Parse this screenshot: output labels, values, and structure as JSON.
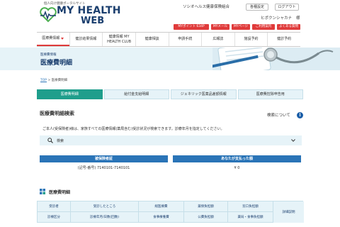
{
  "header": {
    "tagline": "個人向け健康ポータルサイト",
    "logo_line1": "MY HEALTH",
    "logo_line2": "WEB",
    "org_name": "ソシオヘルス健康保険組合",
    "buttons": [
      "各種設定",
      "ログアウト"
    ],
    "user_name": "ヒポクンシャカナ",
    "user_suffix": "様",
    "links": [
      "MYポイント 634P",
      "MYメール",
      "MYページ",
      "ご利用案内",
      "よくある質問"
    ]
  },
  "nav": {
    "items": [
      {
        "label": "医療費情報",
        "dropdown": true
      },
      {
        "label": "健診結果情報",
        "dropdown": false
      },
      {
        "label": "健康情報 MY HEALTH CLUB",
        "dropdown": false
      },
      {
        "label": "健康相談",
        "dropdown": false
      },
      {
        "label": "申請手続",
        "dropdown": false
      },
      {
        "label": "広報誌",
        "dropdown": false
      },
      {
        "label": "施設予約",
        "dropdown": false
      },
      {
        "label": "健診予約",
        "dropdown": false
      }
    ],
    "active_index": 0
  },
  "banner": {
    "subtitle": "医療費情報",
    "title": "医療費明細"
  },
  "breadcrumb": {
    "home": "TOP",
    "separator": ">",
    "current": "医療費明細"
  },
  "tabs": {
    "items": [
      "医療費明細",
      "給付金支給明細",
      "ジェネリック医薬品差額情報",
      "医療費控除申告用"
    ],
    "active_index": 0
  },
  "search_section": {
    "title": "医療費明細検索",
    "help_text": "検索について",
    "help_icon": "info-icon",
    "notice": "ご本人(受保険者)様は、家族すべての医療情報(薬局含む)受診状況が検索できます。診療年月を指定してください。",
    "search_label": "検索"
  },
  "summary": {
    "card_header": "被保険者証",
    "card_value": "(記号-番号) 7140101-7140101",
    "amount_header": "あなたが支払った額",
    "amount_value": "¥ 0"
  },
  "list": {
    "title": "医療費明細",
    "header_row1": [
      "受診者",
      "受診したところ",
      "総医療費",
      "薬保負担額",
      "窓口負担額"
    ],
    "header_row2": [
      "診療区分",
      "診療年月/日数(回数)",
      "食事療養費",
      "公費負担額",
      "薬局・食事負担額"
    ],
    "detail_label": "詳細説明"
  },
  "colors": {
    "brand_navy": "#1a3e6e",
    "accent_red": "#e03b3b",
    "teal_active": "#1f9e8c",
    "blue": "#2a74b7",
    "light_bg": "#e6f3f8"
  }
}
